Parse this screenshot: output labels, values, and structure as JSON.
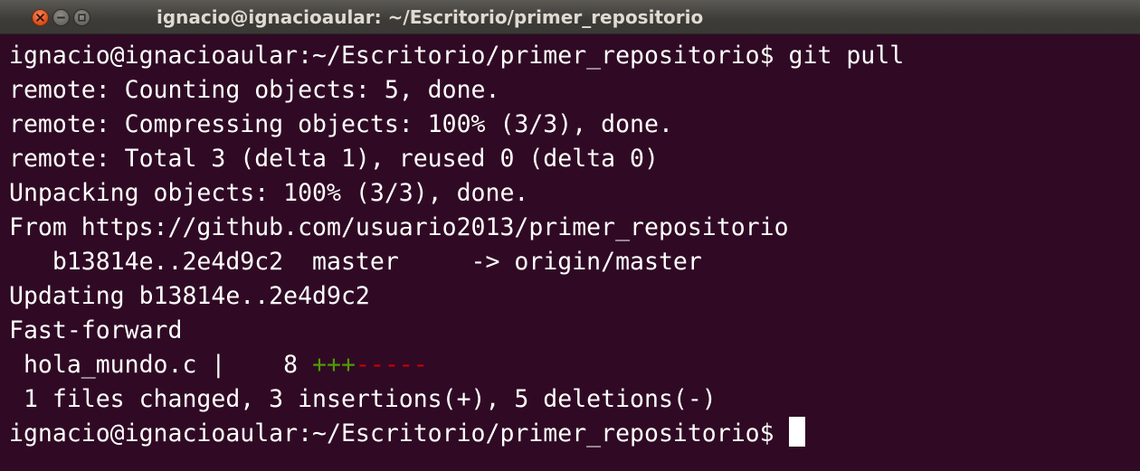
{
  "window": {
    "title": "ignacio@ignacioaular: ~/Escritorio/primer_repositorio",
    "buttons": {
      "close_icon": "close-icon",
      "minimize_icon": "minimize-icon",
      "maximize_icon": "maximize-icon"
    }
  },
  "terminal": {
    "lines": [
      "ignacio@ignacioaular:~/Escritorio/primer_repositorio$ git pull",
      "remote: Counting objects: 5, done.",
      "remote: Compressing objects: 100% (3/3), done.",
      "remote: Total 3 (delta 1), reused 0 (delta 0)",
      "Unpacking objects: 100% (3/3), done.",
      "From https://github.com/usuario2013/primer_repositorio",
      "   b13814e..2e4d9c2  master     -> origin/master",
      "Updating b13814e..2e4d9c2",
      "Fast-forward"
    ],
    "diffstat": {
      "prefix": " hola_mundo.c |    8 ",
      "plus": "+++",
      "minus": "-----"
    },
    "summary": " 1 files changed, 3 insertions(+), 5 deletions(-)",
    "prompt": "ignacio@ignacioaular:~/Escritorio/primer_repositorio$ "
  },
  "colors": {
    "background": "#300a24",
    "text": "#ffffff",
    "insertions": "#4e9a06",
    "deletions": "#cc0000",
    "close_button": "#e0531f"
  }
}
